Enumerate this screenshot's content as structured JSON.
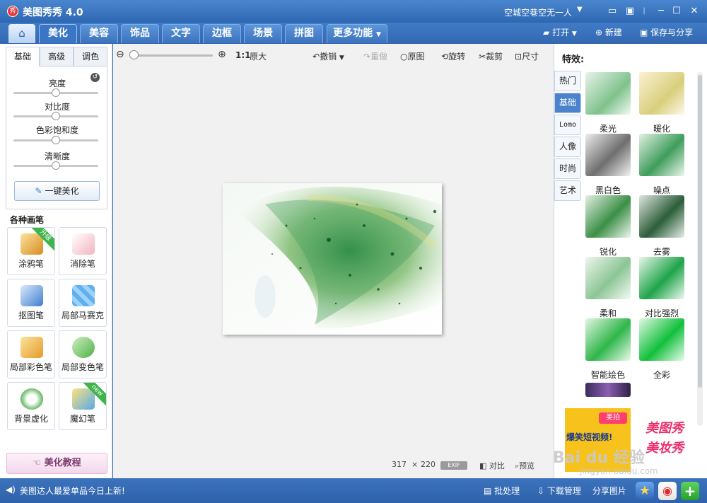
{
  "app": {
    "title": "美图秀秀 4.0",
    "logo_text": "秀",
    "user": "空城空巷空无一人"
  },
  "nav": {
    "tabs": [
      "美化",
      "美容",
      "饰品",
      "文字",
      "边框",
      "场景",
      "拼图"
    ],
    "more": "更多功能",
    "open": "打开",
    "new": "新建",
    "save": "保存与分享"
  },
  "left": {
    "subtabs": [
      "基础",
      "高级",
      "调色"
    ],
    "sliders": [
      {
        "label": "亮度",
        "value": 0.5
      },
      {
        "label": "对比度",
        "value": 0.5
      },
      {
        "label": "色彩饱和度",
        "value": 0.5
      },
      {
        "label": "清晰度",
        "value": 0.5
      }
    ],
    "onekey": "一键美化",
    "brushes_title": "各种画笔",
    "brushes": [
      {
        "label": "涂鸦笔",
        "badge": "升级"
      },
      {
        "label": "消除笔",
        "badge": ""
      },
      {
        "label": "抠图笔",
        "badge": ""
      },
      {
        "label": "局部马赛克",
        "badge": ""
      },
      {
        "label": "局部彩色笔",
        "badge": ""
      },
      {
        "label": "局部变色笔",
        "badge": ""
      },
      {
        "label": "背景虚化",
        "badge": ""
      },
      {
        "label": "魔幻笔",
        "badge": "new"
      }
    ],
    "tutorial": "美化教程"
  },
  "canvas": {
    "zoom_ratio": "1:1",
    "original_size": "原大",
    "undo": "撤销",
    "redo": "重做",
    "original": "原图",
    "rotate": "旋转",
    "crop": "裁剪",
    "size": "尺寸",
    "width": "317",
    "times": "×",
    "height": "220",
    "exif": "EXIF",
    "compare": "对比",
    "preview": "预览"
  },
  "right": {
    "title": "特效:",
    "categories": [
      "热门",
      "基础",
      "Lomo",
      "人像",
      "时尚",
      "艺术"
    ],
    "effects": [
      "柔光",
      "暖化",
      "黑白色",
      "噪点",
      "锐化",
      "去雾",
      "柔和",
      "对比强烈",
      "智能绘色",
      "全彩"
    ],
    "ad_line1": "美图秀",
    "ad_line2": "美妆秀",
    "ad_small": "美拍",
    "ad_video": "爆笑短视频!"
  },
  "status": {
    "news": "美图达人最爱单品今日上新!",
    "batch": "批处理",
    "download": "下载管理",
    "share": "分享图片",
    "watermark": "Bai du 经验",
    "watermark_url": "jingyan.baidu.com"
  },
  "colors": {
    "accent": "#3b75c6",
    "titlebar": "#2e67b1",
    "ribbon": "#3fb44b"
  }
}
